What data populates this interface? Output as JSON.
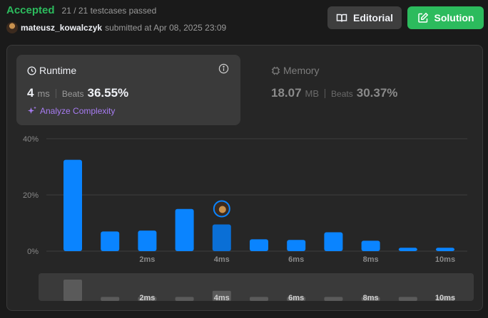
{
  "submission": {
    "status": "Accepted",
    "testcases": "21 / 21 testcases passed",
    "username": "mateusz_kowalczyk",
    "submitted_text": "submitted at Apr 08, 2025 23:09"
  },
  "buttons": {
    "editorial": "Editorial",
    "solution": "Solution"
  },
  "runtime": {
    "title": "Runtime",
    "value": "4",
    "unit": "ms",
    "beats_label": "Beats",
    "beats_value": "36.55%",
    "analyze_label": "Analyze Complexity"
  },
  "memory": {
    "title": "Memory",
    "value": "18.07",
    "unit": "MB",
    "beats_label": "Beats",
    "beats_value": "30.37%"
  },
  "colors": {
    "accepted": "#2cbb5d",
    "bar": "#0a84ff",
    "bar_user": "#0a6fd6",
    "analyze": "#a77cf2"
  },
  "chart_data": {
    "type": "bar",
    "x_tick_labels": [
      "2ms",
      "4ms",
      "6ms",
      "8ms",
      "10ms"
    ],
    "y_tick_labels": [
      "40%",
      "20%",
      "0%"
    ],
    "ylim": [
      0,
      40
    ],
    "values": [
      32.5,
      7,
      7.3,
      15,
      9.5,
      4.2,
      4,
      6.7,
      3.7,
      1.2,
      1.2
    ],
    "user_bar_index": 4,
    "user_runtime_ms": 4,
    "overview_values": [
      8,
      1.5,
      1.5,
      1.5,
      3.8,
      1.5,
      1.5,
      1.5,
      1.5,
      1.5,
      1.5
    ],
    "overview_tick_labels": [
      "2ms",
      "4ms",
      "6ms",
      "8ms",
      "10ms"
    ]
  }
}
